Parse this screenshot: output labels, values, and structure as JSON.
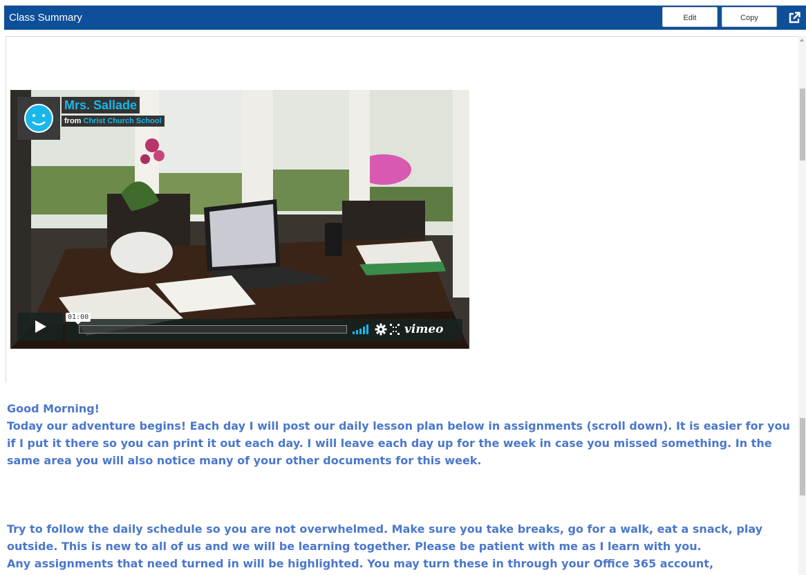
{
  "header": {
    "title": "Class Summary",
    "edit_label": "Edit",
    "copy_label": "Copy",
    "popout_icon": "external-link-icon"
  },
  "video": {
    "uploader_name": "Mrs. Sallade",
    "from_label": "from",
    "school_name": "Christ Church School",
    "timecode": "01:00",
    "brand": "vimeo",
    "accent_color": "#1ab7ea"
  },
  "content": {
    "greeting": "Good Morning!",
    "paragraph1": "Today our adventure begins! Each day I will post our daily lesson plan below in assignments (scroll down). It is easier for you if I put it there so you can print it out each day. I will leave each day up for the week in case you missed something. In the same area you will also notice many of your other documents for this week.",
    "paragraph2a": "Try to follow the daily schedule so you are not overwhelmed. Make sure you take breaks, go for a walk, eat a snack, play outside. This is new to all of us and we will be learning together. Please be patient with me as I learn with you.",
    "paragraph2b": "Any assignments that need turned in will be highlighted. You may turn these in through your Office 365 account,",
    "text_color": "#4a77cc"
  },
  "colors": {
    "header_bg": "#0e4f9a"
  }
}
